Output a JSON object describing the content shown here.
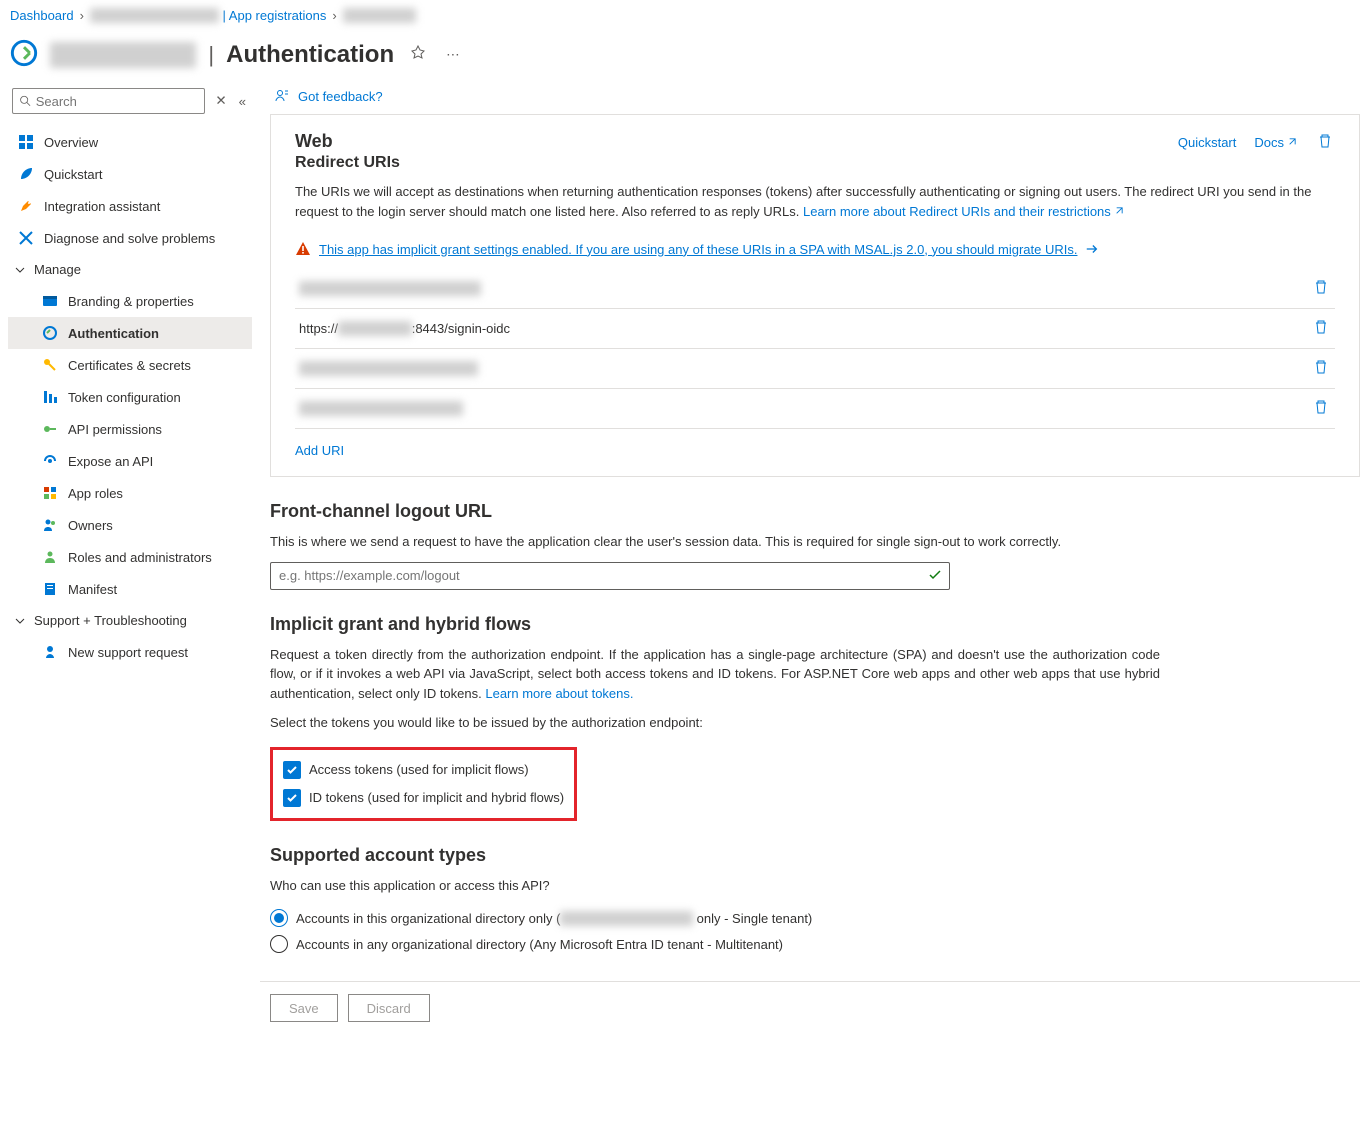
{
  "breadcrumb": {
    "dashboard": "Dashboard",
    "mid_blur": "██████████████",
    "appreg": "App registrations",
    "last_blur": "████████"
  },
  "header": {
    "app_blur": "██████ ███",
    "page": "Authentication"
  },
  "sidebar": {
    "search_placeholder": "Search",
    "items": {
      "overview": "Overview",
      "quickstart": "Quickstart",
      "integration_assist": "Integration assistant",
      "diagnose": "Diagnose and solve problems"
    },
    "group_manage": "Manage",
    "manage_items": {
      "branding": "Branding & properties",
      "authentication": "Authentication",
      "certificates": "Certificates & secrets",
      "token_config": "Token configuration",
      "api_permissions": "API permissions",
      "expose_api": "Expose an API",
      "app_roles": "App roles",
      "owners": "Owners",
      "roles_admins": "Roles and administrators",
      "manifest": "Manifest"
    },
    "group_support": "Support + Troubleshooting",
    "support_items": {
      "new_request": "New support request"
    }
  },
  "feedback": {
    "label": "Got feedback?"
  },
  "web_section": {
    "title": "Web",
    "subtitle": "Redirect URIs",
    "desc": "The URIs we will accept as destinations when returning authentication responses (tokens) after successfully authenticating or signing out users. The redirect URI you send in the request to the login server should match one listed here. Also referred to as reply URLs. ",
    "learn_link": "Learn more about Redirect URIs and their restrictions",
    "quickstart": "Quickstart",
    "docs": "Docs",
    "warning": "This app has implicit grant settings enabled. If you are using any of these URIs in a SPA with MSAL.js 2.0, you should migrate URIs.",
    "uri_blur1": "████ █████████████ ██",
    "uri2": "https://████████████:8443/signin-oidc",
    "uri_blur3": "████ ███████████████",
    "uri_blur4": "████████ █ ████████",
    "add_uri": "Add URI"
  },
  "logout_section": {
    "title": "Front-channel logout URL",
    "desc": "This is where we send a request to have the application clear the user's session data. This is required for single sign-out to work correctly.",
    "placeholder": "e.g. https://example.com/logout"
  },
  "implicit_section": {
    "title": "Implicit grant and hybrid flows",
    "desc": "Request a token directly from the authorization endpoint. If the application has a single-page architecture (SPA) and doesn't use the authorization code flow, or if it invokes a web API via JavaScript, select both access tokens and ID tokens. For ASP.NET Core web apps and other web apps that use hybrid authentication, select only ID tokens. ",
    "learn_link": "Learn more about tokens.",
    "select_label": "Select the tokens you would like to be issued by the authorization endpoint:",
    "access_tokens": "Access tokens (used for implicit flows)",
    "id_tokens": "ID tokens (used for implicit and hybrid flows)"
  },
  "account_section": {
    "title": "Supported account types",
    "desc": "Who can use this application or access this API?",
    "opt1_prefix": "Accounts in this organizational directory only (",
    "opt1_blur": "██████████ ████",
    "opt1_suffix": " only - Single tenant)",
    "opt2": "Accounts in any organizational directory (Any Microsoft Entra ID tenant - Multitenant)"
  },
  "footer": {
    "save": "Save",
    "discard": "Discard"
  }
}
